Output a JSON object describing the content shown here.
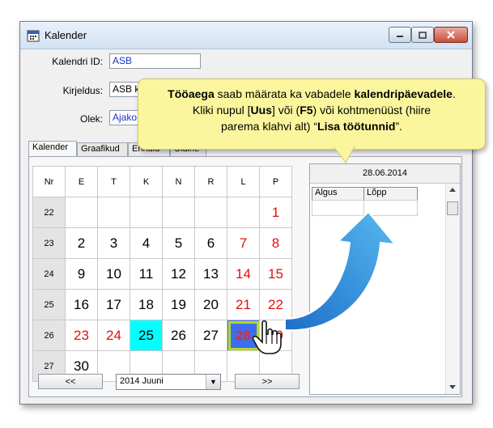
{
  "window": {
    "title": "Kalender"
  },
  "form": {
    "id_label": "Kalendri ID:",
    "id_value": "ASB",
    "desc_label": "Kirjeldus:",
    "desc_value": "ASB k",
    "state_label": "Olek:",
    "state_value": "Ajako"
  },
  "tabs": [
    "Kalender",
    "Graafikud",
    "Erindid",
    "Üldine"
  ],
  "calendar": {
    "headers": [
      "Nr",
      "E",
      "T",
      "K",
      "N",
      "R",
      "L",
      "P"
    ],
    "weeks": [
      "22",
      "23",
      "24",
      "25",
      "26",
      "27"
    ],
    "days": [
      [
        "",
        "",
        "",
        "",
        "",
        "",
        "1"
      ],
      [
        "2",
        "3",
        "4",
        "5",
        "6",
        "7",
        "8"
      ],
      [
        "9",
        "10",
        "11",
        "12",
        "13",
        "14",
        "15"
      ],
      [
        "16",
        "17",
        "18",
        "19",
        "20",
        "21",
        "22"
      ],
      [
        "23",
        "24",
        "25",
        "26",
        "27",
        "28",
        "29"
      ],
      [
        "30",
        "",
        "",
        "",
        "",
        "",
        ""
      ]
    ],
    "today": "25",
    "selected": "28"
  },
  "nav": {
    "prev": "<<",
    "next": ">>",
    "month_value": "2014 Juuni"
  },
  "right_panel": {
    "date": "28.06.2014",
    "col_start": "Algus",
    "col_end": "Lõpp"
  },
  "tooltip": {
    "line1_b1": "Tööaega",
    "line1_t1": " saab määrata ka vabadele ",
    "line1_b2": "kalendripäevadele",
    "line1_t2": ".",
    "line2_t1": "Kliki nupul [",
    "line2_b1": "Uus",
    "line2_t2": "] või (",
    "line2_b2": "F5",
    "line2_t3": ") või kohtmenüüst (hiire",
    "line3_t1": "parema klahvi alt) “",
    "line3_b1": "Lisa töötunnid",
    "line3_t2": "”."
  },
  "colors": {
    "today": "#00ffff",
    "weekend": "#e20f0f",
    "selected_bg": "#3b6ff0",
    "tooltip_bg": "#fbf69d"
  }
}
